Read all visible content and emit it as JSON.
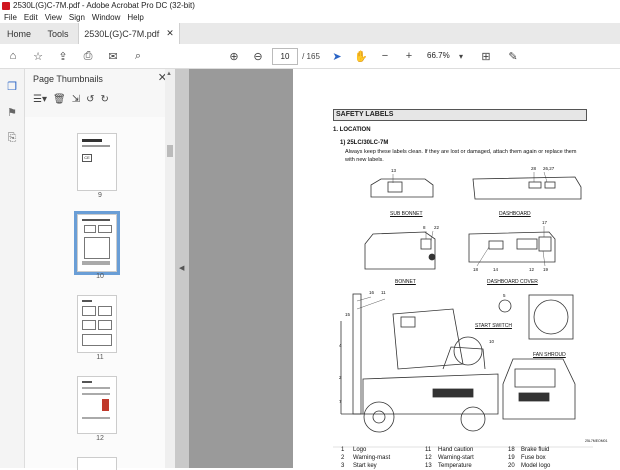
{
  "window": {
    "title": "2530L(G)C-7M.pdf - Adobe Acrobat Pro DC (32-bit)"
  },
  "menu": [
    "File",
    "Edit",
    "View",
    "Sign",
    "Window",
    "Help"
  ],
  "tabs": {
    "home": "Home",
    "tools": "Tools",
    "document": "2530L(G)C-7M.pdf"
  },
  "toolbar": {
    "current_page": "10",
    "total_pages": "/ 165",
    "zoom": "66.7%"
  },
  "panel": {
    "title": "Page Thumbnails",
    "thumbnails": [
      {
        "label": "9"
      },
      {
        "label": "10",
        "selected": true
      },
      {
        "label": "11"
      },
      {
        "label": "12"
      }
    ]
  },
  "document": {
    "section_title": "SAFETY LABELS",
    "heading": "1. LOCATION",
    "subheading": "1) 25LC/30LC-7M",
    "body": "Always keep these labels clean.  If they are lost or damaged, attach them again or replace them",
    "body2": "with new labels.",
    "captions": {
      "sub_bonnet": "SUB BONNET",
      "dashboard": "DASHBOARD",
      "bonnet": "BONNET",
      "dashboard_cover": "DASHBOARD COVER",
      "start_switch": "START SWITCH",
      "fan_shroud": "FAN SHROUD"
    },
    "callouts": [
      "13",
      "28",
      "26,27",
      "8",
      "22",
      "17",
      "18",
      "14",
      "12",
      "19",
      "16",
      "11",
      "15",
      "10",
      "5",
      "4",
      "2",
      "7"
    ],
    "figure_code": "25L7MEOM01",
    "legend": [
      {
        "n": "1",
        "t": "Logo"
      },
      {
        "n": "2",
        "t": "Warning-mast"
      },
      {
        "n": "3",
        "t": "Start key"
      },
      {
        "n": "11",
        "t": "Hand caution"
      },
      {
        "n": "12",
        "t": "Warning-start"
      },
      {
        "n": "13",
        "t": "Temperature"
      },
      {
        "n": "18",
        "t": "Brake fluid"
      },
      {
        "n": "19",
        "t": "Fuse box"
      },
      {
        "n": "20",
        "t": "Model logo"
      }
    ]
  },
  "icons": [
    "home-icon",
    "star-icon",
    "upload-icon",
    "print-icon",
    "mail-icon",
    "search-icon",
    "arrow-up-icon",
    "arrow-down-icon",
    "cursor-icon",
    "hand-icon",
    "zoom-out-icon",
    "zoom-in-icon",
    "fit-page-icon",
    "sign-icon"
  ],
  "colors": {
    "accent": "#d0161f",
    "selection": "#6a9ed6",
    "viewer_bg": "#9a9a9a"
  }
}
